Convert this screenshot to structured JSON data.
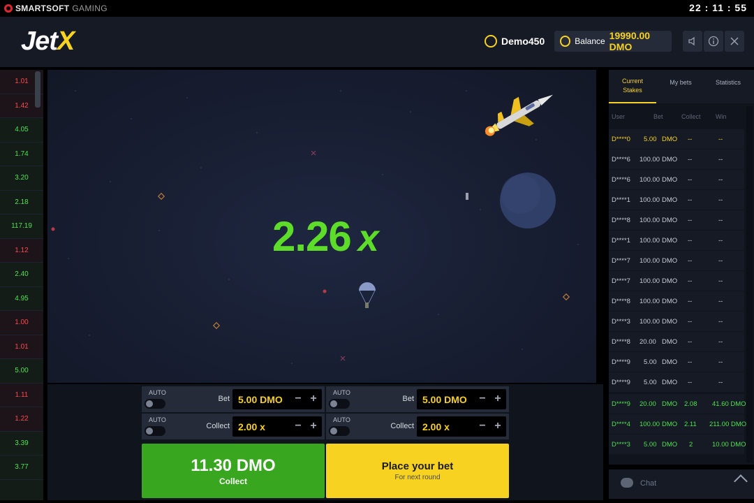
{
  "topbar": {
    "brand_name": "SMARTSOFT",
    "brand_sub": "GAMING",
    "clock": "22 : 11 : 55"
  },
  "header": {
    "logo_main": "Jet",
    "logo_x": "X",
    "username": "Demo450",
    "balance_label": "Balance",
    "balance_value": "19990.00 DMO",
    "icons": [
      "sound-icon",
      "info-icon",
      "close-icon"
    ]
  },
  "history": [
    {
      "v": "1.01",
      "c": "red"
    },
    {
      "v": "1.42",
      "c": "red"
    },
    {
      "v": "4.05",
      "c": "green"
    },
    {
      "v": "1.74",
      "c": "green"
    },
    {
      "v": "3.20",
      "c": "green"
    },
    {
      "v": "2.18",
      "c": "green"
    },
    {
      "v": "117.19",
      "c": "green"
    },
    {
      "v": "1.12",
      "c": "red"
    },
    {
      "v": "2.40",
      "c": "green"
    },
    {
      "v": "4.95",
      "c": "green"
    },
    {
      "v": "1.00",
      "c": "red"
    },
    {
      "v": "1.01",
      "c": "red"
    },
    {
      "v": "5.00",
      "c": "green"
    },
    {
      "v": "1.11",
      "c": "red"
    },
    {
      "v": "1.22",
      "c": "red"
    },
    {
      "v": "3.39",
      "c": "green"
    },
    {
      "v": "3.77",
      "c": "green"
    },
    {
      "v": "",
      "c": "green"
    }
  ],
  "game": {
    "multiplier": "2.26",
    "multiplier_suffix": "x"
  },
  "panels": [
    {
      "auto_label": "AUTO",
      "bet_label": "Bet",
      "bet_value": "5.00 DMO",
      "collect_label": "Collect",
      "collect_value": "2.00 x",
      "minus": "−",
      "plus": "+"
    },
    {
      "auto_label": "AUTO",
      "bet_label": "Bet",
      "bet_value": "5.00 DMO",
      "collect_label": "Collect",
      "collect_value": "2.00 x",
      "minus": "−",
      "plus": "+"
    }
  ],
  "collect_button": {
    "amount": "11.30 DMO",
    "label": "Collect"
  },
  "place_button": {
    "label": "Place your bet",
    "sub": "For next round"
  },
  "tabs": [
    {
      "line1": "Current",
      "line2": "Stakes"
    },
    {
      "line1": "My bets",
      "line2": ""
    },
    {
      "line1": "Statistics",
      "line2": ""
    }
  ],
  "columns": [
    "User",
    "Bet",
    "Collect",
    "Win"
  ],
  "stakes": [
    {
      "user": "D****0",
      "bet": "5.00",
      "cur": "DMO",
      "collect": "--",
      "win": "--",
      "state": "mine"
    },
    {
      "user": "D****6",
      "bet": "100.00",
      "cur": "DMO",
      "collect": "--",
      "win": "--",
      "state": "normal"
    },
    {
      "user": "D****6",
      "bet": "100.00",
      "cur": "DMO",
      "collect": "--",
      "win": "--",
      "state": "normal"
    },
    {
      "user": "D****1",
      "bet": "100.00",
      "cur": "DMO",
      "collect": "--",
      "win": "--",
      "state": "normal"
    },
    {
      "user": "D****8",
      "bet": "100.00",
      "cur": "DMO",
      "collect": "--",
      "win": "--",
      "state": "normal"
    },
    {
      "user": "D****1",
      "bet": "100.00",
      "cur": "DMO",
      "collect": "--",
      "win": "--",
      "state": "normal"
    },
    {
      "user": "D****7",
      "bet": "100.00",
      "cur": "DMO",
      "collect": "--",
      "win": "--",
      "state": "normal"
    },
    {
      "user": "D****7",
      "bet": "100.00",
      "cur": "DMO",
      "collect": "--",
      "win": "--",
      "state": "normal"
    },
    {
      "user": "D****8",
      "bet": "100.00",
      "cur": "DMO",
      "collect": "--",
      "win": "--",
      "state": "normal"
    },
    {
      "user": "D****3",
      "bet": "100.00",
      "cur": "DMO",
      "collect": "--",
      "win": "--",
      "state": "normal"
    },
    {
      "user": "D****8",
      "bet": "20.00",
      "cur": "DMO",
      "collect": "--",
      "win": "--",
      "state": "normal"
    },
    {
      "user": "D****9",
      "bet": "5.00",
      "cur": "DMO",
      "collect": "--",
      "win": "--",
      "state": "normal"
    },
    {
      "user": "D****9",
      "bet": "5.00",
      "cur": "DMO",
      "collect": "--",
      "win": "--",
      "state": "normal"
    },
    {
      "user": "D****9",
      "bet": "20.00",
      "cur": "DMO",
      "collect": "2.08",
      "win": "41.60 DMO",
      "state": "won"
    },
    {
      "user": "D****4",
      "bet": "100.00",
      "cur": "DMO",
      "collect": "2.11",
      "win": "211.00 DMO",
      "state": "won"
    },
    {
      "user": "D****3",
      "bet": "5.00",
      "cur": "DMO",
      "collect": "2",
      "win": "10.00 DMO",
      "state": "won"
    }
  ],
  "chat": {
    "label": "Chat"
  },
  "colors": {
    "accent": "#f7d221",
    "win": "#4ee24e",
    "loss": "#ff4850",
    "collect_bg": "#38a61f"
  }
}
